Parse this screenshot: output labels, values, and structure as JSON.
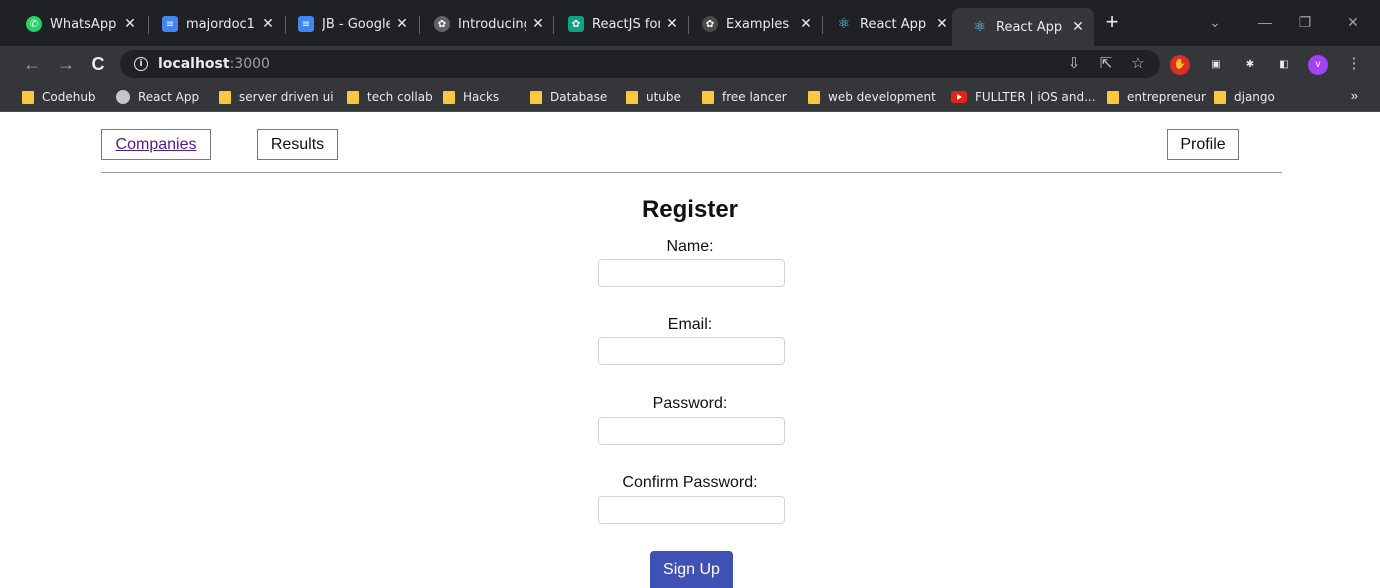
{
  "browser": {
    "tabs": [
      {
        "title": "WhatsApp",
        "icon": "whatsapp-icon",
        "color": "#25d366"
      },
      {
        "title": "majordoc1 -",
        "icon": "google-docs-icon",
        "color": "#4285f4"
      },
      {
        "title": "JB - Google",
        "icon": "google-docs-icon",
        "color": "#4285f4"
      },
      {
        "title": "Introducing",
        "icon": "openai-icon",
        "color": "#9aa0a6"
      },
      {
        "title": "ReactJS for",
        "icon": "chatgpt-icon",
        "color": "#10a37f"
      },
      {
        "title": "Examples -",
        "icon": "openai-icon",
        "color": "#6e6e6e"
      },
      {
        "title": "React App",
        "icon": "react-icon",
        "color": "#61dafb"
      },
      {
        "title": "React App",
        "icon": "react-icon",
        "color": "#61dafb"
      }
    ],
    "active_tab_index": 7,
    "url_host": "localhost",
    "url_port": ":3000",
    "profile_initial": "v",
    "bookmarks": [
      {
        "label": "Codehub",
        "icon": "folder-icon"
      },
      {
        "label": "React App",
        "icon": "globe-icon"
      },
      {
        "label": "server driven ui",
        "icon": "folder-icon"
      },
      {
        "label": "tech collab",
        "icon": "folder-icon"
      },
      {
        "label": "Hacks",
        "icon": "folder-icon"
      },
      {
        "label": "Database",
        "icon": "folder-icon"
      },
      {
        "label": "utube",
        "icon": "folder-icon"
      },
      {
        "label": "free lancer",
        "icon": "folder-icon"
      },
      {
        "label": "web development",
        "icon": "folder-icon"
      },
      {
        "label": "FULLTER | iOS and...",
        "icon": "youtube-icon"
      },
      {
        "label": "entrepreneur",
        "icon": "folder-icon"
      },
      {
        "label": "django",
        "icon": "folder-icon"
      }
    ],
    "bookmarks_more": "»"
  },
  "nav": {
    "companies": "Companies",
    "results": "Results",
    "profile": "Profile"
  },
  "form": {
    "title": "Register",
    "name_label": "Name:",
    "name_value": "",
    "email_label": "Email:",
    "email_value": "",
    "password_label": "Password:",
    "password_value": "",
    "confirm_label": "Confirm Password:",
    "confirm_value": "",
    "submit_label": "Sign Up",
    "button_color": "#3f51b5"
  }
}
